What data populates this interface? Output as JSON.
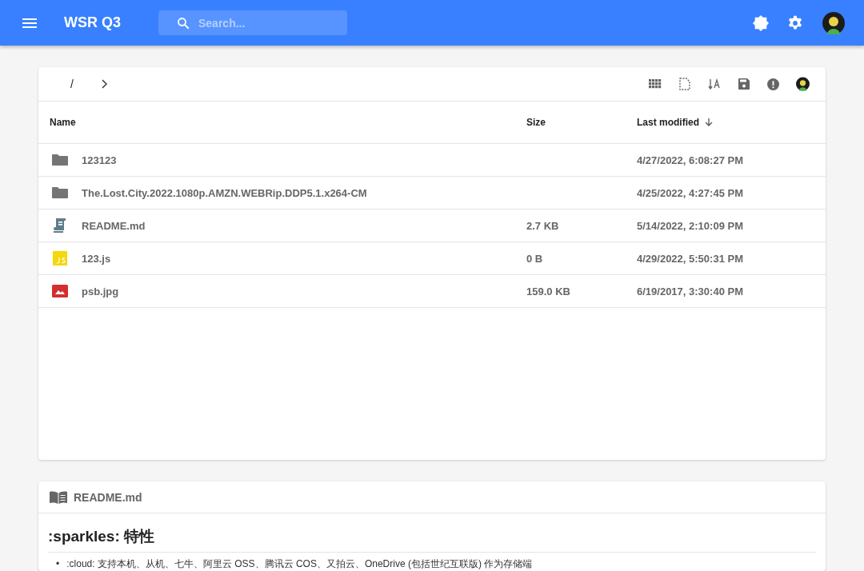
{
  "app_bar": {
    "title": "WSR Q3",
    "search": {
      "placeholder": "Search..."
    }
  },
  "breadcrumb": {
    "path": "/"
  },
  "table": {
    "columns": [
      {
        "label": "Name",
        "sorted": false
      },
      {
        "label": "Size",
        "sorted": false
      },
      {
        "label": "Last modified",
        "sorted": true
      }
    ],
    "rows": [
      {
        "kind": "folder",
        "name": "123123",
        "modified": "4/27/2022, 6:08:27 PM"
      },
      {
        "kind": "folder",
        "name": "The.Lost.City.2022.1080p.AMZN.WEBRip.DDP5.1.x264-CM",
        "modified": "4/25/2022, 4:27:45 PM"
      },
      {
        "kind": "markdown",
        "name": "README.md",
        "size": "2.7 KB",
        "modified": "5/14/2022, 2:10:09 PM"
      },
      {
        "kind": "js",
        "name": "123.js",
        "size": "0 B",
        "modified": "4/29/2022, 5:50:31 PM"
      },
      {
        "kind": "image",
        "name": "psb.jpg",
        "size": "159.0 KB",
        "modified": "6/19/2017, 3:30:40 PM"
      }
    ]
  },
  "readme": {
    "title": "README.md",
    "heading": ":sparkles: 特性",
    "items": [
      {
        "marker": "•",
        "text": ":cloud: 支持本机、从机、七牛、阿里云 OSS、腾讯云 COS、又拍云、OneDrive (包括世纪互联版) 作为存储端"
      }
    ]
  }
}
